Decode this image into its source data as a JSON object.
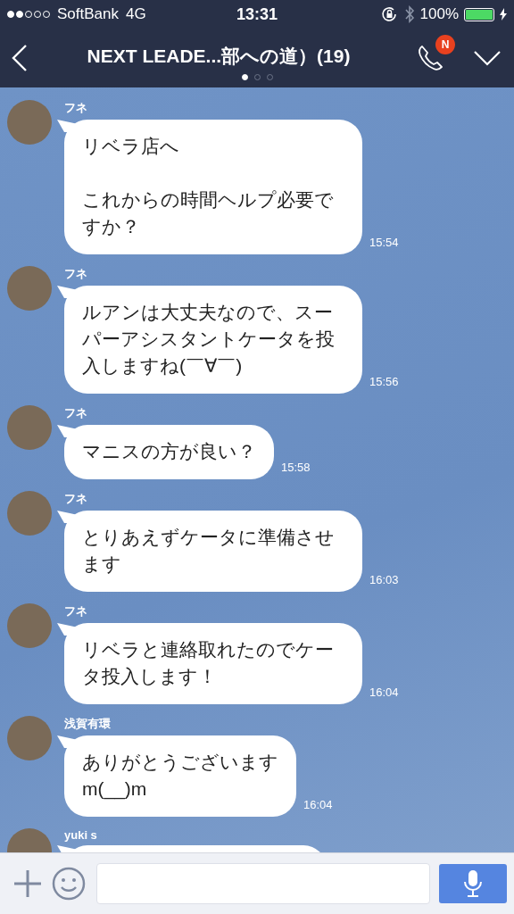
{
  "status_bar": {
    "signal_dots": [
      {
        "on": true
      },
      {
        "on": true
      },
      {
        "on": false
      },
      {
        "on": false
      },
      {
        "on": false
      }
    ],
    "carrier": "SoftBank",
    "network": "4G",
    "time": "13:31",
    "battery": "100%"
  },
  "header": {
    "title": "NEXT LEADE...部への道）(19)",
    "call_badge": "N",
    "pages": [
      {
        "selected": true
      },
      {
        "selected": false
      },
      {
        "selected": false
      }
    ]
  },
  "messages": [
    {
      "sender": "フネ",
      "paragraphs": [
        "リベラ店へ",
        "これからの時間ヘルプ必要ですか？"
      ],
      "blank_line": true,
      "time": "15:54"
    },
    {
      "sender": "フネ",
      "paragraphs": [
        "ルアンは大丈夫なので、スーパーアシスタントケータを投入しますね(￣∀￣)"
      ],
      "time": "15:56"
    },
    {
      "sender": "フネ",
      "paragraphs": [
        "マニスの方が良い？"
      ],
      "time": "15:58"
    },
    {
      "sender": "フネ",
      "paragraphs": [
        "とりあえずケータに準備させます"
      ],
      "time": "16:03"
    },
    {
      "sender": "フネ",
      "paragraphs": [
        "リベラと連絡取れたのでケータ投入します！"
      ],
      "time": "16:04"
    },
    {
      "sender": "浅賀有環",
      "paragraphs": [
        "ありがとうございます",
        "m(__)m"
      ],
      "time": "16:04"
    },
    {
      "sender": "yuki s"
    }
  ]
}
